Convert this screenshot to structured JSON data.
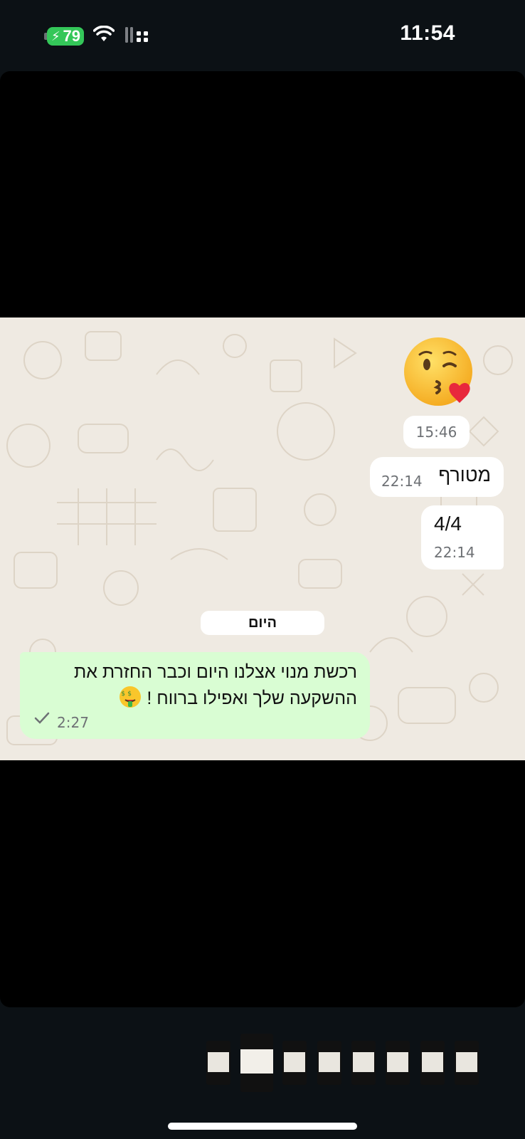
{
  "status_bar": {
    "time": "11:54",
    "battery_level": "79",
    "battery_color": "#34c759",
    "icons": [
      "charging-bolt-icon",
      "wifi-icon",
      "cellular-signal-icon"
    ]
  },
  "chat": {
    "background_color": "#efeae2",
    "sticker": {
      "icon": "kissing-face-emoji"
    },
    "time_chip": "15:46",
    "messages": [
      {
        "text": "מטורף",
        "time": "22:14"
      },
      {
        "text": "4/4",
        "time": "22:14"
      }
    ],
    "day_label": "היום",
    "outgoing": {
      "line1": "רכשת מנוי אצלנו היום וכבר החזרת את",
      "line2": "ההשקעה שלך ואפילו ברווח !",
      "emoji": "money-mouth-face-emoji",
      "time": "2:27",
      "status_icon": "single-check-icon",
      "bubble_color": "#d9fdd3"
    }
  },
  "thumbnail_strip": {
    "count": 8,
    "active_index": 1
  }
}
